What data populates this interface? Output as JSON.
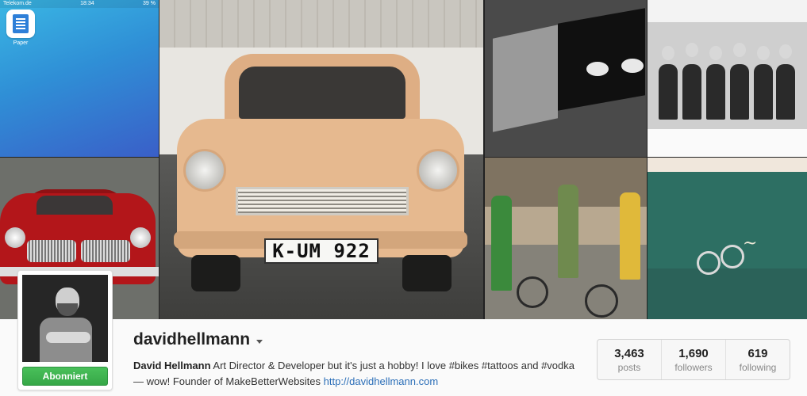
{
  "phone": {
    "carrier": "Telekom.de",
    "time": "18:34",
    "battery": "39 %",
    "app_label": "Paper"
  },
  "photos": {
    "plate_text": "K-UM 922"
  },
  "profile": {
    "username": "davidhellmann",
    "follow_label": "Abonniert",
    "bio_name": "David Hellmann",
    "bio_text": " Art Director & Developer but it's just a hobby! I love #bikes #tattoos and #vodka — wow! Founder of MakeBetterWebsites ",
    "bio_link": "http://davidhellmann.com"
  },
  "stats": [
    {
      "value": "3,463",
      "label": "posts"
    },
    {
      "value": "1,690",
      "label": "followers"
    },
    {
      "value": "619",
      "label": "following"
    }
  ],
  "colors": {
    "follow_green": "#3cb04c",
    "link_blue": "#2c6fb8"
  }
}
